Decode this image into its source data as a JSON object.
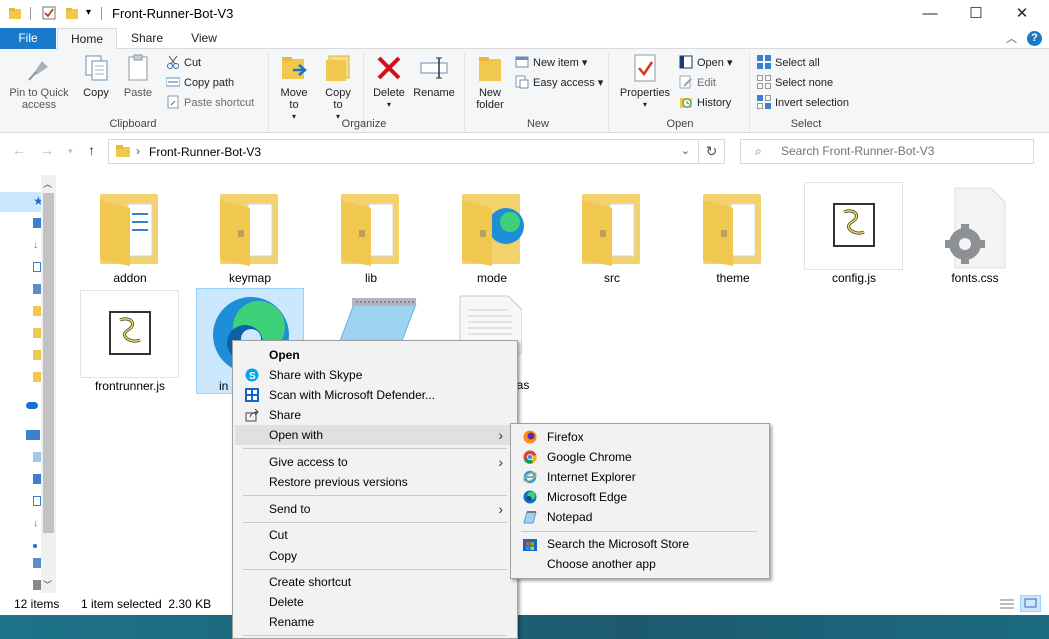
{
  "window": {
    "title": "Front-Runner-Bot-V3",
    "minimize": "—",
    "maximize": "☐",
    "close": "✕"
  },
  "ribbon_tabs": [
    "File",
    "Home",
    "Share",
    "View"
  ],
  "ribbon": {
    "clipboard": {
      "label": "Clipboard",
      "pin": "Pin to Quick access",
      "copy": "Copy",
      "paste": "Paste",
      "cut": "Cut",
      "copy_path": "Copy path",
      "paste_shortcut": "Paste shortcut"
    },
    "organize": {
      "label": "Organize",
      "move_to": "Move to",
      "copy_to": "Copy to",
      "delete": "Delete",
      "rename": "Rename"
    },
    "new": {
      "label": "New",
      "new_folder": "New folder",
      "new_item": "New item",
      "easy_access": "Easy access"
    },
    "open": {
      "label": "Open",
      "properties": "Properties",
      "open": "Open",
      "edit": "Edit",
      "history": "History"
    },
    "select": {
      "label": "Select",
      "select_all": "Select all",
      "select_none": "Select none",
      "invert": "Invert selection"
    }
  },
  "address": {
    "path": "Front-Runner-Bot-V3",
    "search_placeholder": "Search Front-Runner-Bot-V3"
  },
  "files": [
    {
      "name": "addon",
      "type": "folder"
    },
    {
      "name": "keymap",
      "type": "folder"
    },
    {
      "name": "lib",
      "type": "folder"
    },
    {
      "name": "mode",
      "type": "folder"
    },
    {
      "name": "src",
      "type": "folder"
    },
    {
      "name": "theme",
      "type": "folder"
    },
    {
      "name": "config.js",
      "type": "js"
    },
    {
      "name": "fonts.css",
      "type": "css"
    },
    {
      "name": "frontrunner.js",
      "type": "js"
    },
    {
      "name": "in",
      "type": "html",
      "selected": true
    },
    {
      "name": "",
      "type": "notepad"
    },
    {
      "name": "has",
      "type": "text"
    }
  ],
  "status": {
    "count": "12 items",
    "selection": "1 item selected  2.30 KB"
  },
  "context_menu": {
    "items": [
      "Open",
      "Share with Skype",
      "Scan with Microsoft Defender...",
      "Share",
      "Open with",
      "Give access to",
      "Restore previous versions",
      "Send to",
      "Cut",
      "Copy",
      "Create shortcut",
      "Delete",
      "Rename"
    ]
  },
  "open_with_menu": {
    "items": [
      "Firefox",
      "Google Chrome",
      "Internet Explorer",
      "Microsoft Edge",
      "Notepad",
      "Search the Microsoft Store",
      "Choose another app"
    ]
  }
}
